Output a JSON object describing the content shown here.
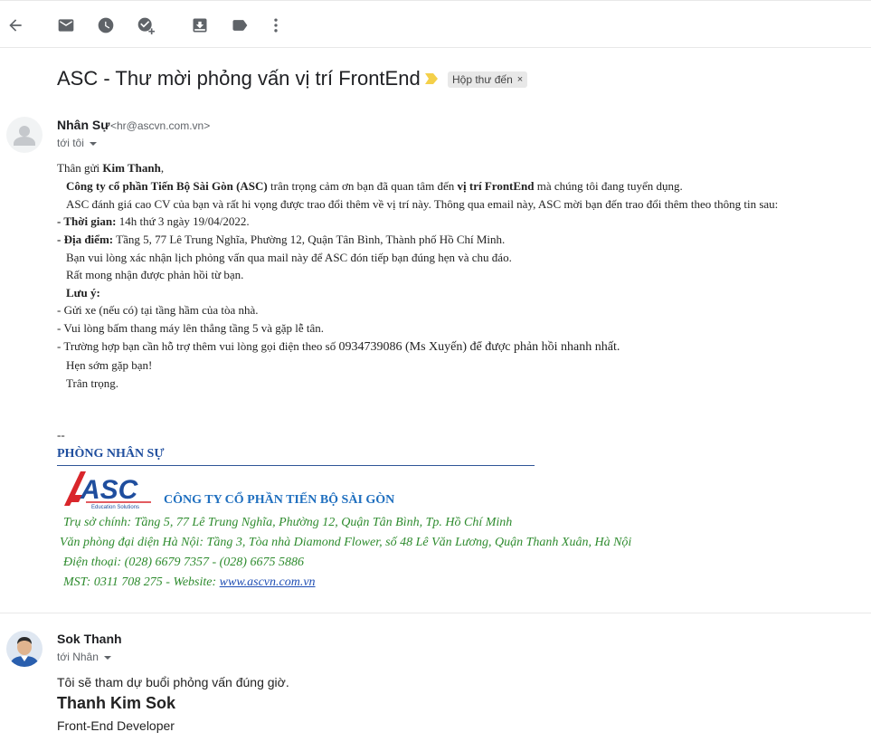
{
  "toolbar": {
    "icons": [
      "back-arrow-icon",
      "mark-unread-icon",
      "snooze-icon",
      "add-task-icon",
      "move-to-icon",
      "label-icon",
      "more-vert-icon"
    ]
  },
  "email": {
    "subject": "ASC - Thư mời phỏng vấn vị trí FrontEnd",
    "label_chip": "Hộp thư đến",
    "label_chip_close": "×",
    "accent_importance": "#f4d04a"
  },
  "message1": {
    "sender_name": "Nhân Sự",
    "sender_email": "<hr@ascvn.com.vn>",
    "to_line": "tới tôi",
    "greeting_prefix": "Thân gửi ",
    "greeting_name": "Kim Thanh",
    "greeting_suffix": ",",
    "p1_bold1": "Công ty cổ phần Tiến Bộ Sài Gòn (ASC)",
    "p1_mid": " trân trọng cảm ơn bạn đã quan tâm đến ",
    "p1_bold2": "vị trí FrontEnd",
    "p1_end": " mà chúng tôi đang tuyển dụng.",
    "p2": "ASC đánh giá cao CV của bạn và rất hi vọng được trao đổi thêm về vị trí này. Thông qua email này, ASC mời bạn đến trao đổi thêm theo thông tin sau:",
    "time_label": "- Thời gian:",
    "time_value": " 14h thứ 3 ngày 19/04/2022.",
    "place_label": "- Địa điểm:",
    "place_value": " Tầng 5, 77 Lê Trung Nghĩa, Phường 12, Quận Tân Bình, Thành phố Hồ Chí Minh.",
    "confirm": "Bạn vui lòng xác nhận lịch phỏng vấn qua mail này để ASC đón tiếp bạn đúng hẹn và chu đáo.",
    "hope": "Rất mong nhận được phản hồi từ bạn.",
    "note_label": "Lưu ý:",
    "note1": "- Gửi xe (nếu có) tại tầng hầm của tòa nhà.",
    "note2": "- Vui lòng bấm thang máy lên thẳng tầng 5 và gặp lễ tân.",
    "note3_a": "- Trường hợp bạn cần hỗ trợ thêm vui lòng gọi điện theo số ",
    "note3_b": "0934739086 (Ms Xuyến) để được phản hồi nhanh nhất.",
    "see_you": "Hẹn sớm gặp bạn!",
    "regards": "Trân trọng.",
    "sig_dash": "--",
    "dept": "PHÒNG NHÂN SỰ",
    "logo_text": "ASC",
    "logo_sub": "Education Solutions",
    "company": "CÔNG TY CỔ PHẦN TIẾN BỘ SÀI GÒN",
    "hq": "Trụ sở chính: Tầng 5, 77 Lê Trung Nghĩa, Phường 12, Quận Tân Bình, Tp. Hồ Chí Minh",
    "hn": "Văn phòng đại diện Hà Nội: Tầng 3, Tòa nhà Diamond Flower, số 48 Lê Văn Lương, Quận Thanh Xuân, Hà Nội",
    "phone": "Điện thoại: (028) 6679 7357 - (028) 6675 5886",
    "mst_prefix": "MST: 0311 708 275 - Website: ",
    "website": "www.ascvn.com.vn",
    "colors": {
      "dept_blue": "#1f4e9e",
      "green_italic": "#2e8b2e"
    }
  },
  "message2": {
    "sender_name": "Sok Thanh",
    "to_line": "tới Nhân",
    "reply": "Tôi sẽ tham dự buổi phỏng vấn đúng giờ.",
    "sig_name": "Thanh Kim Sok",
    "sig_role": "Front-End Developer"
  }
}
